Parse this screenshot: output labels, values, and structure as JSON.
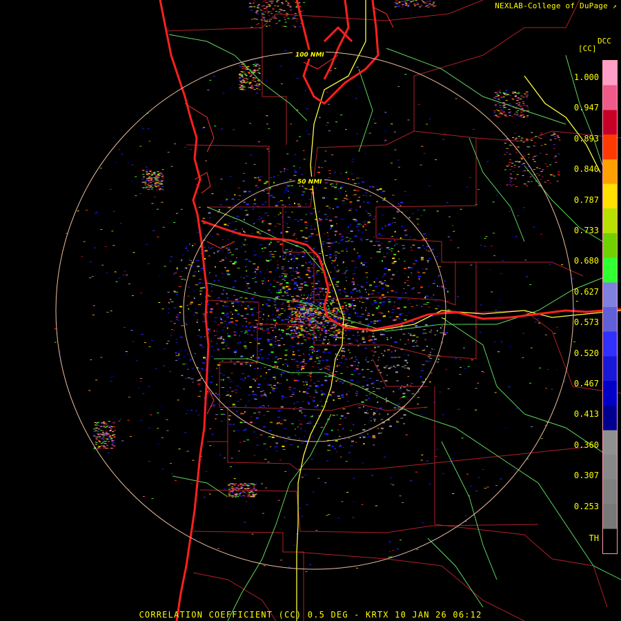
{
  "header": {
    "credit": "NEXLAB-College of DuPage"
  },
  "footer": {
    "caption": "CORRELATION COEFFICIENT (CC) 0.5 DEG - KRTX 10 JAN 26 06:12"
  },
  "range_rings": [
    {
      "label": "100 NMI"
    },
    {
      "label": "50 NMI"
    }
  ],
  "legend": {
    "product": "DCC",
    "unit": "[CC]",
    "labels": [
      "1.000",
      "0.947",
      "0.893",
      "0.840",
      "0.787",
      "0.733",
      "0.680",
      "0.627",
      "0.573",
      "0.520",
      "0.467",
      "0.413",
      "0.360",
      "0.307",
      "0.253",
      "TH"
    ],
    "colors": [
      "#ff9fc8",
      "#ee5a8a",
      "#c80028",
      "#ff3a00",
      "#ffa000",
      "#ffe000",
      "#b8e000",
      "#70d000",
      "#30ff30",
      "#8080e0",
      "#6060d8",
      "#3030ff",
      "#1818d8",
      "#0000c8",
      "#000090",
      "#909090",
      "#888888",
      "#808080",
      "#787878",
      "#000000"
    ]
  },
  "colors": {
    "text": "#ffff00",
    "state_border": "#ff2020",
    "county_border": "#b0202a",
    "highway": "#ffff40",
    "roads": "#60d860",
    "range_ring": "#f0c0a0"
  }
}
